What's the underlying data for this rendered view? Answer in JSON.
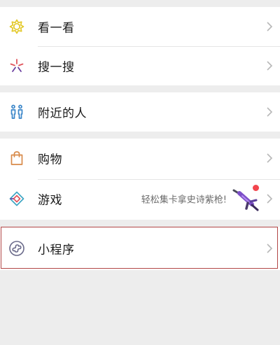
{
  "menu": {
    "group1": [
      {
        "label": "看一看",
        "icon": "kanyikan-icon"
      },
      {
        "label": "搜一搜",
        "icon": "souyisou-icon"
      }
    ],
    "group2": [
      {
        "label": "附近的人",
        "icon": "people-nearby-icon"
      }
    ],
    "group3": [
      {
        "label": "购物",
        "icon": "shopping-bag-icon"
      },
      {
        "label": "游戏",
        "icon": "game-icon",
        "promo": "轻松集卡拿史诗紫枪!"
      }
    ],
    "group4": [
      {
        "label": "小程序",
        "icon": "mini-program-icon"
      }
    ]
  },
  "colors": {
    "background": "#ededed",
    "card": "#ffffff",
    "badge": "#f2454d",
    "highlight_border": "#b24747"
  }
}
